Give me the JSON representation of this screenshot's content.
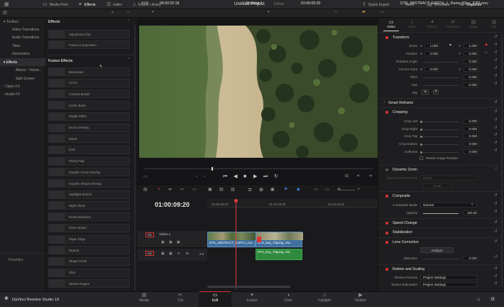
{
  "topbar": {
    "media_pool": "Media Pool",
    "effects": "Effects",
    "index": "Index",
    "sound_library": "Sound Library",
    "project_title": "Untitled Project",
    "edited": "Edited",
    "quick_export": "Quick Export",
    "mixer": "Mixer",
    "metadata": "Metadata",
    "inspector": "Inspector"
  },
  "bar2": {
    "zoom": "41%",
    "source_tc": "00:00:32:18",
    "timeline": "Timeline 1",
    "record_tc": "01:00:09:20",
    "clip_name": "DTS_ABSTRACT_EARTH_J...Bania_Clips_ID82.mov"
  },
  "tree": {
    "items": [
      "Toolbox",
      "Video Transitions",
      "Audio Transitions",
      "Titles",
      "Generators",
      "Effects",
      "Allavio - Volum...",
      "Split Screen",
      "Open FX",
      "Audio FX"
    ],
    "favorites": "Favorites"
  },
  "effects": {
    "section_effects": "Effects",
    "top_items": [
      "Adjustment Clip",
      "Fusion Composition"
    ],
    "section_fusion": "Fusion Effects",
    "fusion_items": [
      "Binoculars",
      "CCTV",
      "Colored Border",
      "Comic Book",
      "Digital Glitch",
      "Drone Overlay",
      "DSLR",
      "DVE",
      "Flying Flag",
      "Graphic Cross Overlay",
      "Graphic Shape Overlay",
      "Highlight Stretch",
      "Night Vision",
      "Noise Distortion",
      "Outer Stroke",
      "Paper Edge",
      "Repeat",
      "Shape Circle",
      "Slice",
      "Stretch Region"
    ]
  },
  "timeline": {
    "timecode": "01:00:09:20",
    "ruler": [
      "01:00:00:00",
      "01:00:20:00",
      "01:00:40:00"
    ],
    "v1": "V1",
    "v1_name": "Video 1",
    "a1": "A1",
    "a1_vol": "2.0",
    "clip_v1": "DTS_ABSTRACT_EARTH_Jos...",
    "clip_v2": "DTS_Day_Tripping_Vid...",
    "clip_a1": "DTS_Day_Tripping_Vid..."
  },
  "inspector": {
    "tabs": [
      "Video",
      "Audio",
      "Effects",
      "Transition",
      "Image",
      "File"
    ],
    "transform": "Transform",
    "zoom_label": "Zoom",
    "zoom_x": "1.000",
    "zoom_y": "1.000",
    "position_label": "Position",
    "pos_x": "0.000",
    "pos_y": "0.000",
    "rotation_label": "Rotation Angle",
    "rotation": "0.000",
    "anchor_label": "Anchor Point",
    "anchor_x": "0.000",
    "anchor_y": "0.000",
    "pitch_label": "Pitch",
    "pitch": "0.000",
    "yaw_label": "Yaw",
    "yaw": "0.000",
    "flip_label": "Flip",
    "smart_reframe": "Smart Reframe",
    "cropping": "Cropping",
    "crop_left_label": "Crop Left",
    "crop_left": "0.000",
    "crop_right_label": "Crop Right",
    "crop_right": "0.000",
    "crop_top_label": "Crop Top",
    "crop_top": "0.000",
    "crop_bottom_label": "Crop Bottom",
    "crop_bottom": "0.000",
    "softness_label": "Softness",
    "softness": "0.000",
    "retain_label": "Retain Image Position",
    "dynamic_zoom": "Dynamic Zoom",
    "dz_ease_label": "Dynamic Zoom Ease",
    "dz_ease": "Linear",
    "swap": "Swap",
    "composite": "Composite",
    "composite_mode_label": "Composite Mode",
    "composite_mode": "Normal",
    "opacity_label": "Opacity",
    "opacity": "100.00",
    "speed_change": "Speed Change",
    "stabilization": "Stabilization",
    "lens_correction": "Lens Correction",
    "analyze": "Analyze",
    "distortion_label": "Distortion",
    "distortion": "0.000",
    "retime": "Retime and Scaling",
    "retime_process_label": "Retime Process",
    "retime_process": "Project Settings",
    "motion_est_label": "Motion Estimation",
    "motion_est": "Project Settings",
    "x": "X",
    "y": "Y"
  },
  "bottom": {
    "app": "DaVinci Resolve Studio 19",
    "pages": [
      "Media",
      "Cut",
      "Edit",
      "Fusion",
      "Color",
      "Fairlight",
      "Deliver"
    ]
  },
  "colors": {
    "accent": "#d63a3a",
    "clip_video": "#3e6f9e",
    "clip_audio": "#2f8a3e",
    "playhead": "#e23b3b"
  }
}
